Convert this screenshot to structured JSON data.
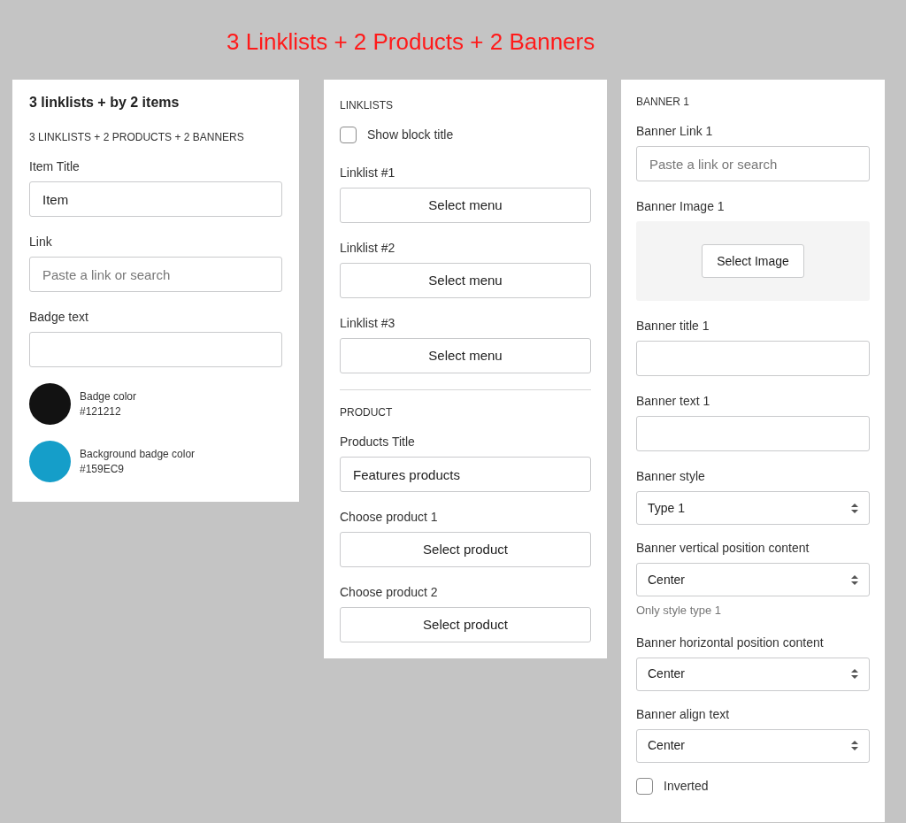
{
  "page_title": "3 Linklists + 2 Products + 2 Banners",
  "panels": [
    {
      "items": [
        {
          "kind": "title",
          "text": "3 linklists + by 2 items"
        },
        {
          "kind": "section",
          "text": "3 LINKLISTS + 2 PRODUCTS + 2 BANNERS"
        },
        {
          "kind": "text",
          "label": "Item Title",
          "value": "Item"
        },
        {
          "kind": "text",
          "label": "Link",
          "placeholder": "Paste a link or search"
        },
        {
          "kind": "text",
          "label": "Badge text"
        },
        {
          "kind": "color",
          "label": "Badge color",
          "value": "#121212",
          "color": "#121212"
        },
        {
          "kind": "color",
          "label": "Background badge color",
          "value": "#159EC9",
          "color": "#159ec9"
        }
      ]
    },
    {
      "items": [
        {
          "kind": "section",
          "text": "LINKLISTS"
        },
        {
          "kind": "checkbox",
          "label": "Show block title",
          "checked": false
        },
        {
          "kind": "button",
          "label": "Linklist #1",
          "button": "Select menu"
        },
        {
          "kind": "button",
          "label": "Linklist #2",
          "button": "Select menu"
        },
        {
          "kind": "button",
          "label": "Linklist #3",
          "button": "Select menu"
        },
        {
          "kind": "divider"
        },
        {
          "kind": "section",
          "text": "PRODUCT"
        },
        {
          "kind": "text",
          "label": "Products Title",
          "value": "Features products"
        },
        {
          "kind": "button",
          "label": "Choose product 1",
          "button": "Select product"
        },
        {
          "kind": "button",
          "label": "Choose product 2",
          "button": "Select product"
        }
      ]
    },
    {
      "items": [
        {
          "kind": "section",
          "text": "BANNER 1"
        },
        {
          "kind": "text",
          "label": "Banner Link 1",
          "placeholder": "Paste a link or search"
        },
        {
          "kind": "image",
          "label": "Banner Image 1",
          "button": "Select Image"
        },
        {
          "kind": "text",
          "label": "Banner title 1"
        },
        {
          "kind": "text",
          "label": "Banner text 1"
        },
        {
          "kind": "select",
          "label": "Banner style",
          "value": "Type 1"
        },
        {
          "kind": "select",
          "label": "Banner vertical position content",
          "value": "Center",
          "note": "Only style type 1"
        },
        {
          "kind": "select",
          "label": "Banner horizontal position content",
          "value": "Center"
        },
        {
          "kind": "select",
          "label": "Banner align text",
          "value": "Center"
        },
        {
          "kind": "checkbox",
          "label": "Inverted",
          "checked": false
        }
      ]
    }
  ]
}
